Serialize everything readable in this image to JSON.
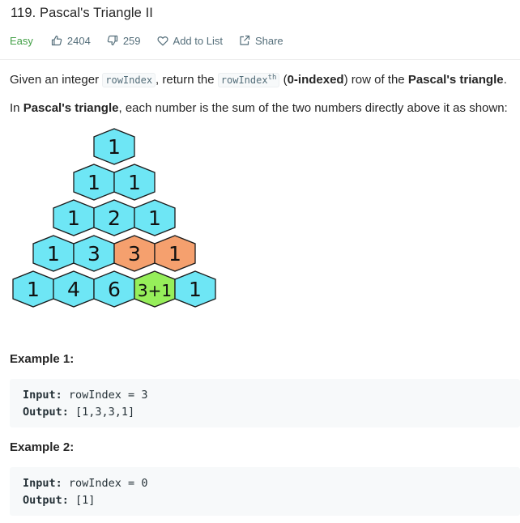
{
  "problem": {
    "title": "119. Pascal's Triangle II",
    "difficulty": "Easy",
    "likes": "2404",
    "dislikes": "259",
    "add_to_list": "Add to List",
    "share": "Share"
  },
  "description": {
    "p1_given": "Given an integer",
    "p1_code1": "rowIndex",
    "p1_return": ", return the",
    "p1_code2": "rowIndex",
    "p1_sup": "th",
    "p1_open": "(",
    "p1_zero": "0-indexed",
    "p1_rowof": ") row of the",
    "p1_pascal": "Pascal's triangle",
    "p1_end": ".",
    "p2_in": "In",
    "p2_pascal": "Pascal's triangle",
    "p2_rest": ", each number is the sum of the two numbers directly above it as shown:"
  },
  "triangle": {
    "rows": [
      [
        "1"
      ],
      [
        "1",
        "1"
      ],
      [
        "1",
        "2",
        "1"
      ],
      [
        "1",
        "3",
        "3",
        "1"
      ],
      [
        "1",
        "4",
        "6",
        "3+1",
        "1"
      ]
    ],
    "highlight_sources": [
      [
        3,
        2
      ],
      [
        3,
        3
      ]
    ],
    "highlight_target": [
      4,
      3
    ],
    "colors": {
      "default": "#6ee6f5",
      "source": "#f5a06e",
      "target": "#96ee5a",
      "stroke": "#1a1a1a"
    }
  },
  "examples": [
    {
      "title": "Example 1:",
      "input_label": "Input:",
      "input": " rowIndex = 3",
      "output_label": "Output:",
      "output": " [1,3,3,1]"
    },
    {
      "title": "Example 2:",
      "input_label": "Input:",
      "input": " rowIndex = 0",
      "output_label": "Output:",
      "output": " [1]"
    }
  ]
}
